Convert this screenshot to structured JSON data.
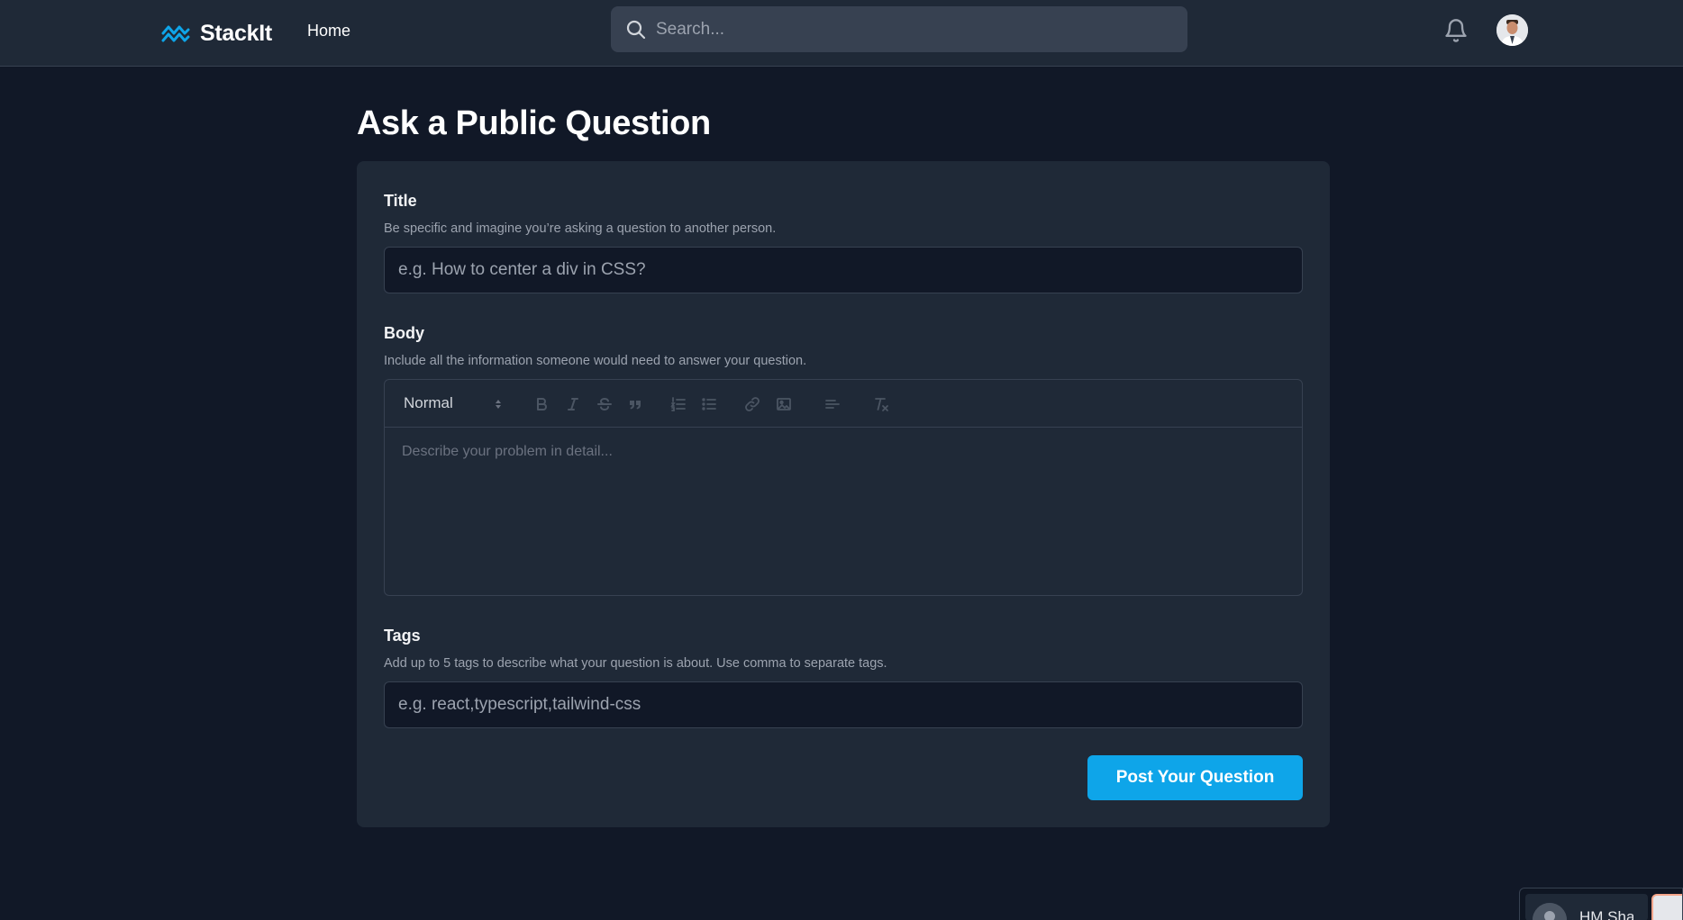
{
  "nav": {
    "brand": "StackIt",
    "home_label": "Home",
    "search_placeholder": "Search..."
  },
  "icons": {
    "logo": "double-wave-icon",
    "search": "search-icon",
    "notifications": "bell-icon"
  },
  "colors": {
    "background": "#111827",
    "surface": "#1f2937",
    "accent": "#0ea5e9",
    "brand_icon": "#0ea5e9"
  },
  "page": {
    "title": "Ask a Public Question"
  },
  "form": {
    "title_label": "Title",
    "title_hint": "Be specific and imagine you’re asking a question to another person.",
    "title_placeholder": "e.g. How to center a div in CSS?",
    "body_label": "Body",
    "body_hint": "Include all the information someone would need to answer your question.",
    "editor": {
      "format_value": "Normal",
      "placeholder": "Describe your problem in detail...",
      "toolbar": [
        "bold",
        "italic",
        "strike",
        "blockquote",
        "ordered-list",
        "bullet-list",
        "link",
        "image",
        "align",
        "clean"
      ]
    },
    "tags_label": "Tags",
    "tags_hint": "Add up to 5 tags to describe what your question is about. Use comma to separate tags.",
    "tags_placeholder": "e.g. react,typescript,tailwind-css",
    "submit_label": "Post Your Question"
  },
  "chat_widget": {
    "name": "HM Sha"
  }
}
